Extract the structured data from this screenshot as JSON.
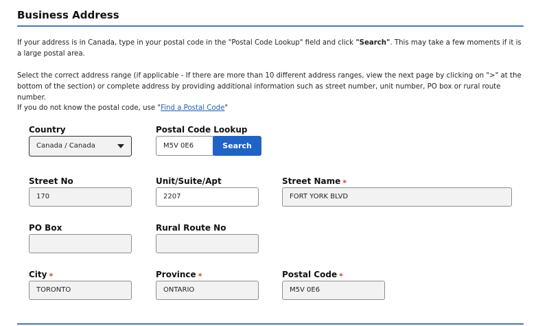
{
  "section": {
    "title": "Business Address"
  },
  "instructions": {
    "p1_before": "If your address is in Canada, type in your postal code in the \"Postal Code Lookup\" field and click ",
    "p1_bold": "\"Search\"",
    "p1_after": ". This may take a few moments if it is a large postal area.",
    "p2": "Select the correct address range (if applicable - If there are more than 10 different address ranges, view the next page by clicking on \">\" at the bottom of the section) or complete address by providing additional information such as street number, unit number, PO box or rural route number.",
    "p3_before": "If you do not know the postal code, use \"",
    "p3_link": "Find a Postal Code",
    "p3_after": "\""
  },
  "country": {
    "label": "Country",
    "value": "Canada / Canada"
  },
  "postal_lookup": {
    "label": "Postal Code Lookup",
    "value": "M5V 0E6",
    "button": "Search"
  },
  "street_no": {
    "label": "Street No",
    "value": "170"
  },
  "unit": {
    "label": "Unit/Suite/Apt",
    "value": "2207"
  },
  "street_name": {
    "label": "Street Name",
    "value": "FORT YORK BLVD",
    "required_mark": "*"
  },
  "po_box": {
    "label": "PO Box",
    "value": ""
  },
  "rural_route": {
    "label": "Rural Route No",
    "value": ""
  },
  "city": {
    "label": "City",
    "value": "TORONTO",
    "required_mark": "*"
  },
  "province": {
    "label": "Province",
    "value": "ONTARIO",
    "required_mark": "*"
  },
  "postal_code": {
    "label": "Postal Code",
    "value": "M5V 0E6",
    "required_mark": "*"
  },
  "colors": {
    "accent": "#3f78c8",
    "button": "#1f63c6",
    "required": "#d9362b",
    "link": "#1a5fb4"
  },
  "icons": {
    "dropdown": "chevron-down-icon"
  }
}
